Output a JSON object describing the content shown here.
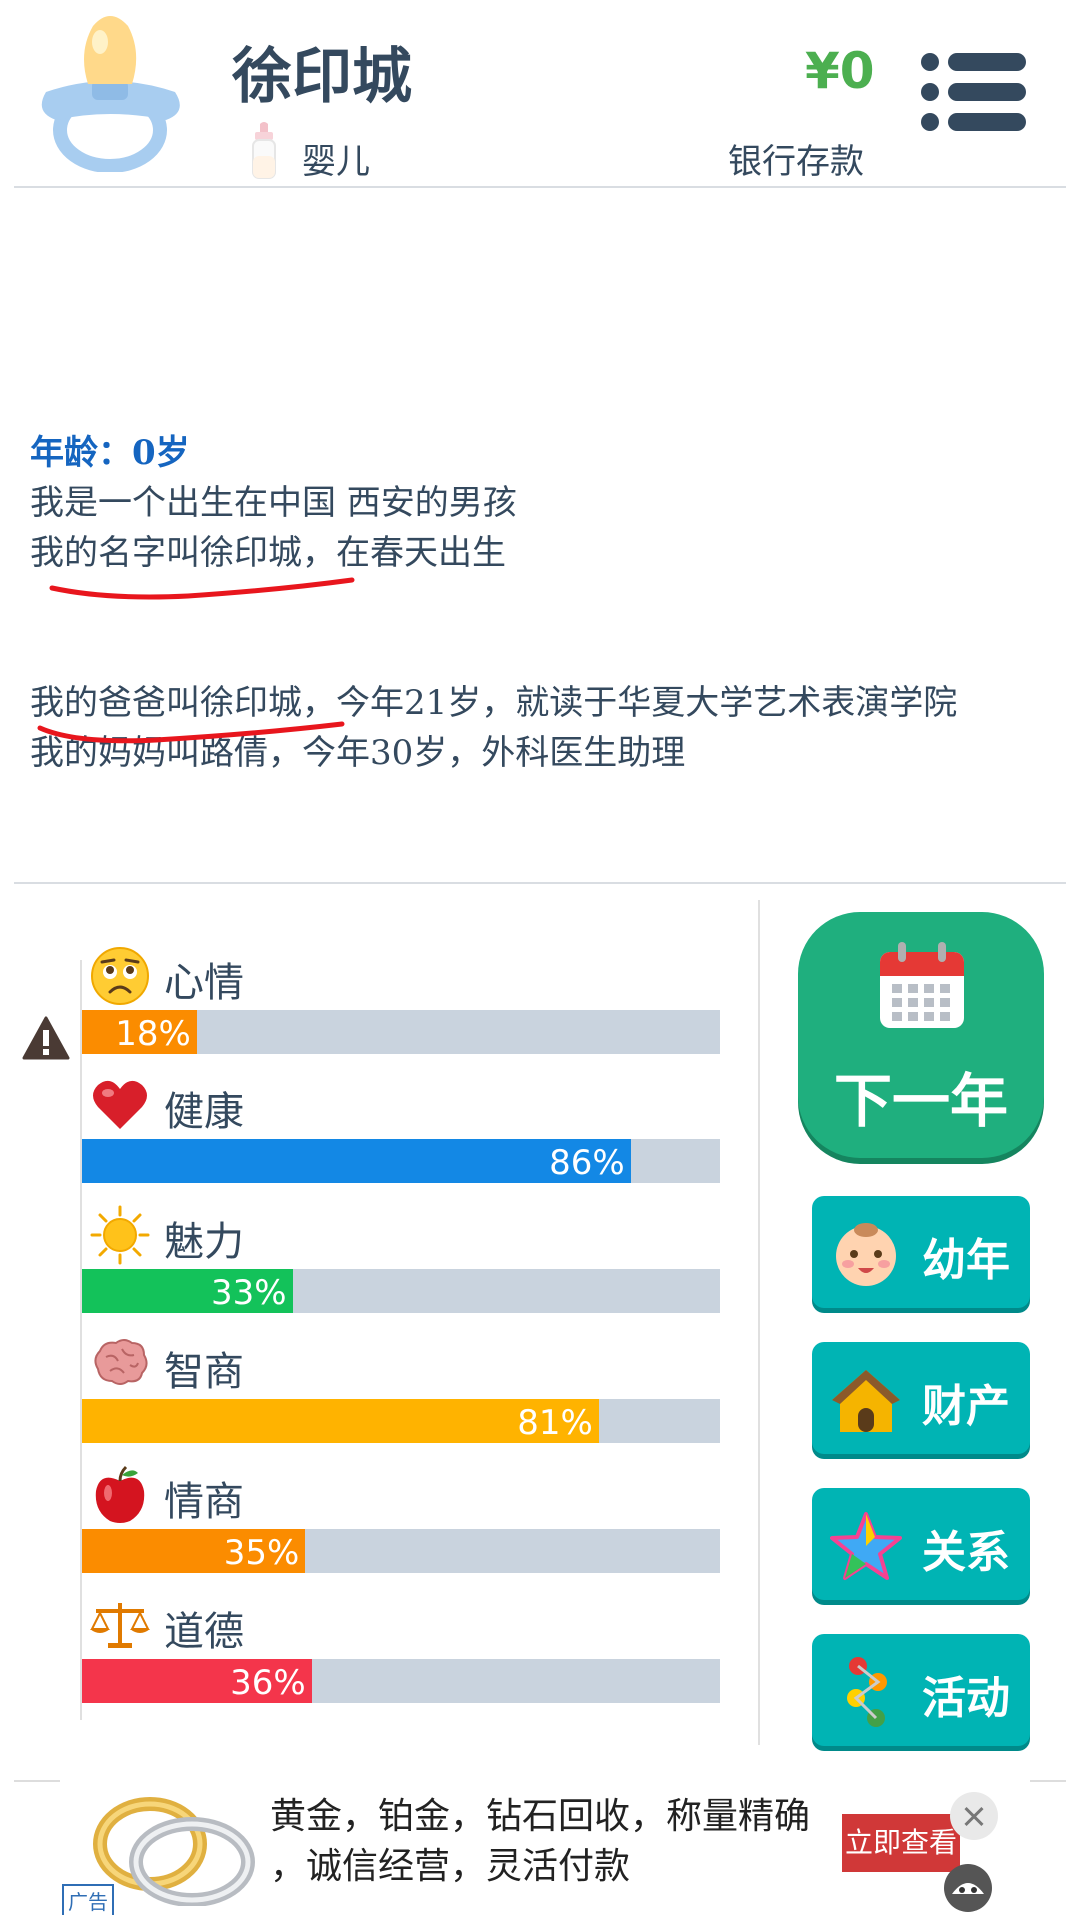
{
  "header": {
    "player_name": "徐印城",
    "stage": "婴儿",
    "money": "¥0",
    "money_label": "银行存款"
  },
  "story": {
    "age_line": "年龄：0岁",
    "lines_a": [
      "我是一个出生在中国 西安的男孩",
      "我的名字叫徐印城，在春天出生"
    ],
    "lines_b": [
      "我的爸爸叫徐印城，今年21岁，就读于华夏大学艺术表演学院",
      "我的妈妈叫路倩，今年30岁，外科医生助理"
    ]
  },
  "stats": [
    {
      "label": "心情",
      "percent": 18,
      "pct_text": "18%",
      "color": "#fb8c00",
      "icon": "worried-face-icon",
      "warning": true
    },
    {
      "label": "健康",
      "percent": 86,
      "pct_text": "86%",
      "color": "#1388e5",
      "icon": "heart-icon",
      "warning": false
    },
    {
      "label": "魅力",
      "percent": 33,
      "pct_text": "33%",
      "color": "#13c25a",
      "icon": "sun-icon",
      "warning": false
    },
    {
      "label": "智商",
      "percent": 81,
      "pct_text": "81%",
      "color": "#ffb300",
      "icon": "brain-icon",
      "warning": false
    },
    {
      "label": "情商",
      "percent": 35,
      "pct_text": "35%",
      "color": "#fb8c00",
      "icon": "apple-icon",
      "warning": false
    },
    {
      "label": "道德",
      "percent": 36,
      "pct_text": "36%",
      "color": "#f4354b",
      "icon": "scales-icon",
      "warning": false
    }
  ],
  "actions": {
    "next_year": "下一年",
    "childhood": "幼年",
    "assets": "财产",
    "relations": "关系",
    "activities": "活动"
  },
  "ad": {
    "badge": "广告",
    "text_line1": "黄金，铂金，钻石回收，称量精确",
    "text_line2": "，诚信经营，灵活付款",
    "cta": "立即查看"
  },
  "colors": {
    "header_text": "#34495e",
    "money": "#4caf50",
    "age": "#1565c0",
    "next_year_btn": "#1faf7e",
    "side_btn": "#00b4b4",
    "track": "#c9d3de"
  }
}
